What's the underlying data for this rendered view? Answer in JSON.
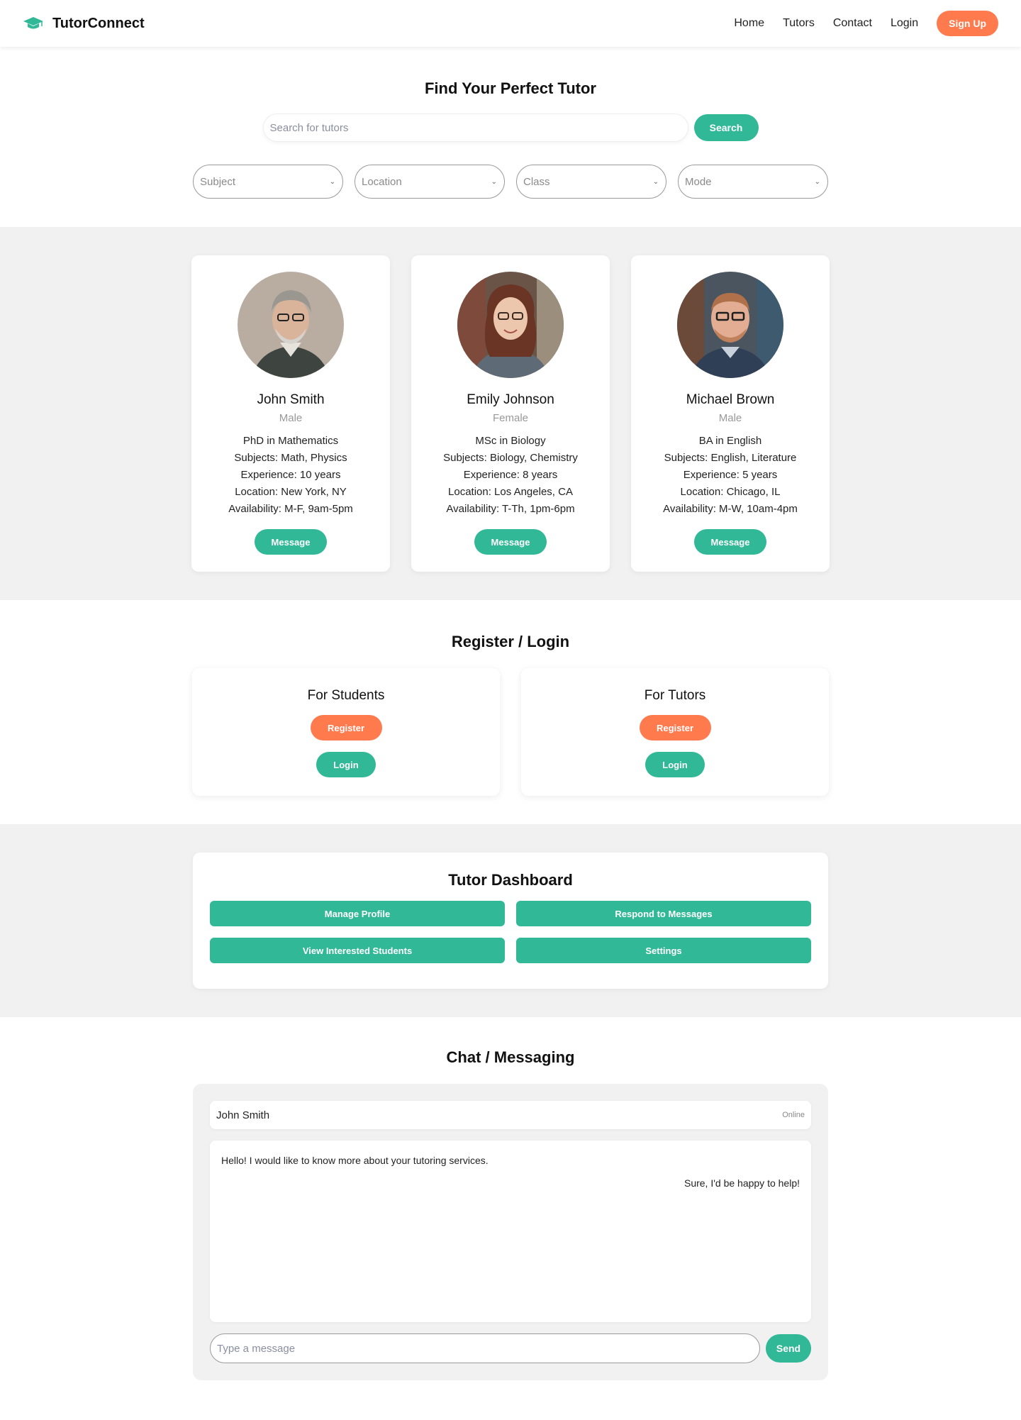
{
  "colors": {
    "accent": "#31b897",
    "brand_orange": "#ff7a4d",
    "section_gray": "#f1f1f1"
  },
  "header": {
    "logo_icon": "graduation-cap-icon",
    "brand": "TutorConnect",
    "nav": [
      "Home",
      "Tutors",
      "Contact",
      "Login"
    ],
    "signup_label": "Sign Up"
  },
  "search": {
    "title": "Find Your Perfect Tutor",
    "placeholder": "Search for tutors",
    "button_label": "Search",
    "filters": [
      "Subject",
      "Location",
      "Class",
      "Mode"
    ]
  },
  "tutors": [
    {
      "name": "John Smith",
      "gender": "Male",
      "degree": "PhD in Mathematics",
      "subjects": "Subjects: Math, Physics",
      "experience": "Experience: 10 years",
      "location": "Location: New York, NY",
      "availability": "Availability: M-F, 9am-5pm",
      "button_label": "Message"
    },
    {
      "name": "Emily Johnson",
      "gender": "Female",
      "degree": "MSc in Biology",
      "subjects": "Subjects: Biology, Chemistry",
      "experience": "Experience: 8 years",
      "location": "Location: Los Angeles, CA",
      "availability": "Availability: T-Th, 1pm-6pm",
      "button_label": "Message"
    },
    {
      "name": "Michael Brown",
      "gender": "Male",
      "degree": "BA in English",
      "subjects": "Subjects: English, Literature",
      "experience": "Experience: 5 years",
      "location": "Location: Chicago, IL",
      "availability": "Availability: M-W, 10am-4pm",
      "button_label": "Message"
    }
  ],
  "auth": {
    "title": "Register / Login",
    "cards": [
      {
        "title": "For Students",
        "register_label": "Register",
        "login_label": "Login"
      },
      {
        "title": "For Tutors",
        "register_label": "Register",
        "login_label": "Login"
      }
    ]
  },
  "dashboard": {
    "title": "Tutor Dashboard",
    "buttons": [
      "Manage Profile",
      "Respond to Messages",
      "View Interested Students",
      "Settings"
    ]
  },
  "chat": {
    "title": "Chat / Messaging",
    "contact": "John Smith",
    "status": "Online",
    "messages": [
      {
        "text": "Hello! I would like to know more about your tutoring services.",
        "side": "left"
      },
      {
        "text": "Sure, I'd be happy to help!",
        "side": "right"
      }
    ],
    "input_placeholder": "Type a message",
    "send_label": "Send"
  }
}
